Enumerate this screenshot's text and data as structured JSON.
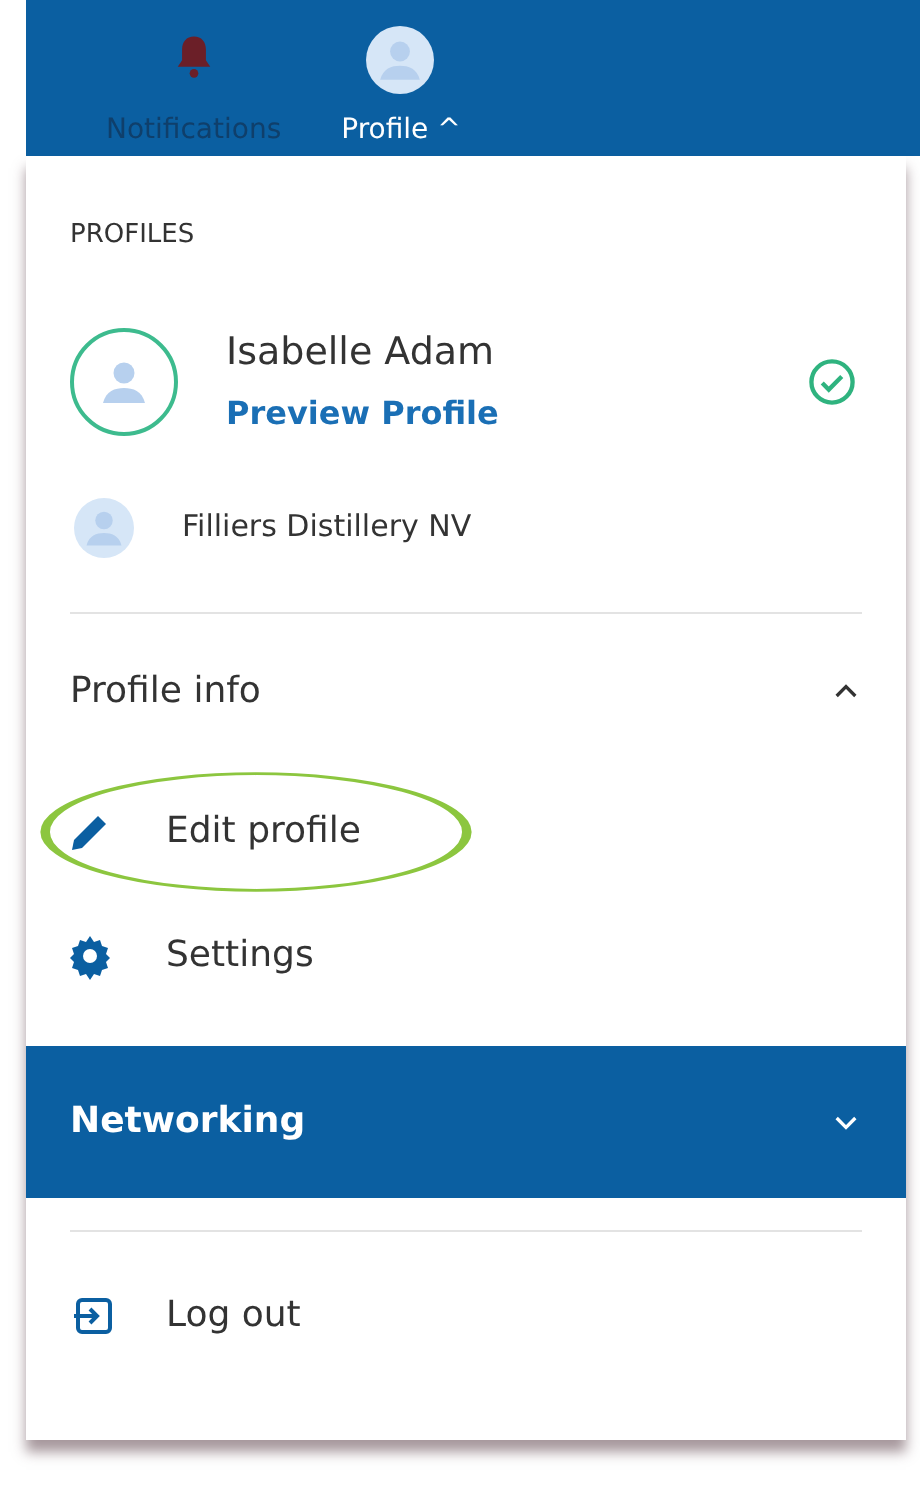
{
  "top_bar": {
    "items": [
      {
        "kind": "bell",
        "label": "Notifications",
        "selected": false
      },
      {
        "kind": "avatar",
        "label": "Profile ^",
        "selected": true
      }
    ]
  },
  "profiles": {
    "heading": "PROFILES",
    "items": [
      {
        "name": "Isabelle Adam",
        "link": "Preview Profile",
        "selected": true
      },
      {
        "name": "Filliers Distillery NV",
        "selected": false
      }
    ]
  },
  "sections": [
    {
      "title": "Profile info",
      "expanded": true,
      "items": [
        {
          "kind": "pencil",
          "label": "Edit profile",
          "highlighted": true
        },
        {
          "kind": "gear",
          "label": "Settings",
          "highlighted": false
        }
      ]
    },
    {
      "title": "Networking",
      "expanded": false
    }
  ],
  "logout": {
    "label": "Log out"
  }
}
